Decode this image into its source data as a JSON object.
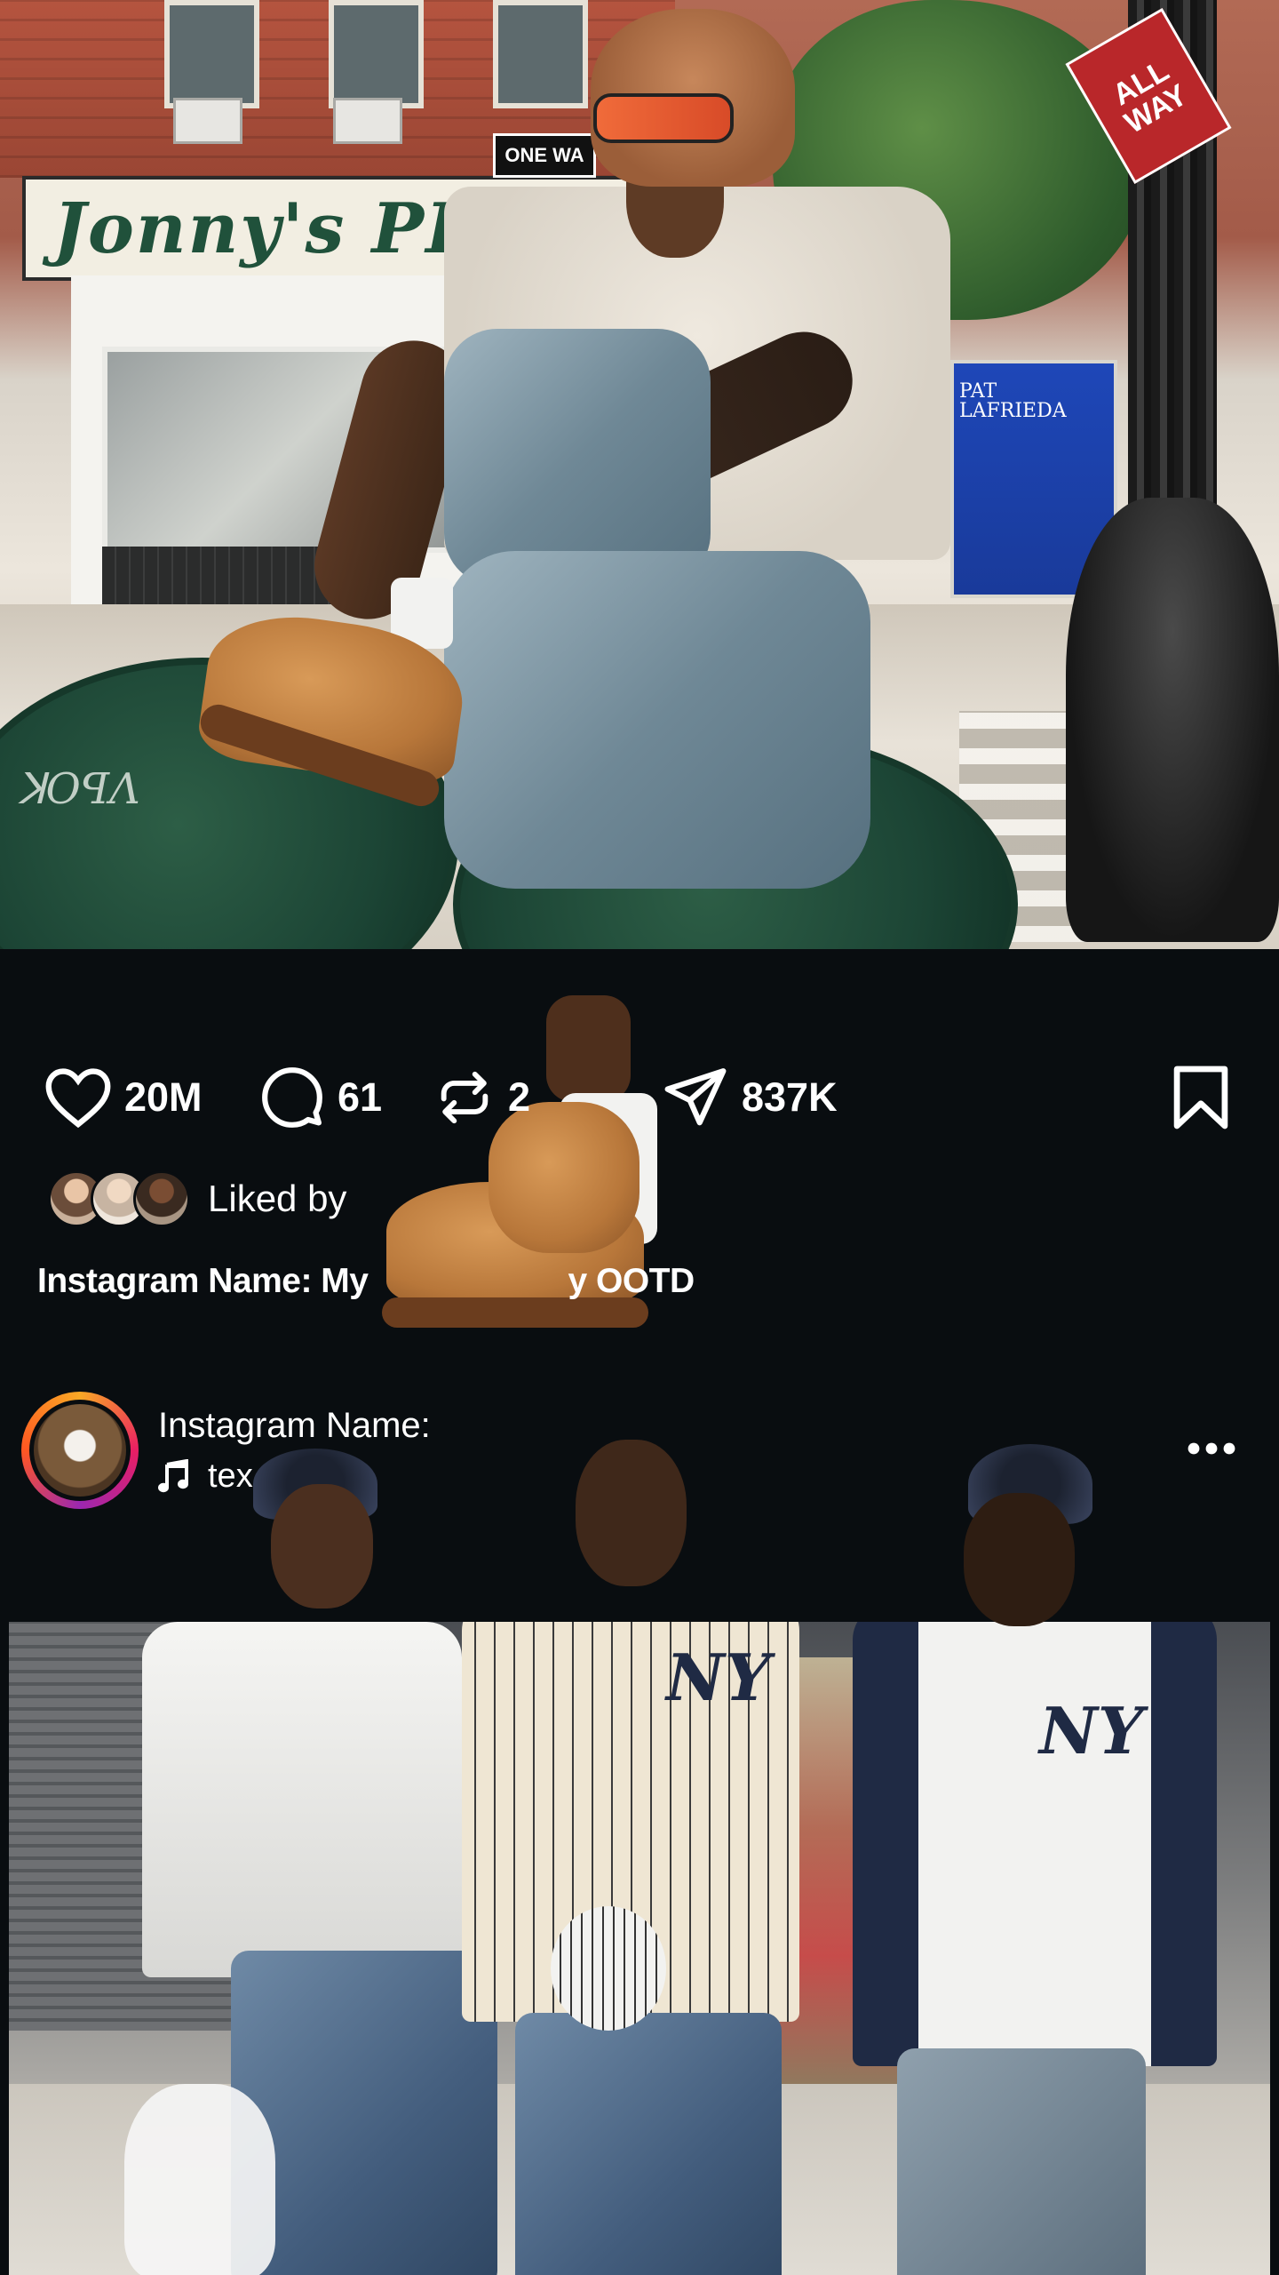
{
  "post1": {
    "actions": {
      "likes": "20M",
      "comments": "61",
      "reposts": "2",
      "shares": "837K"
    },
    "liked_by_label": "Liked by",
    "caption": "Instagram Name: My",
    "caption_tail": "y OOTD",
    "photo_text": {
      "sign": "Jonny's PIZZA",
      "one_way": "ONE WA",
      "all_way": "ALL WAY",
      "truck": "PAT LAFRIEDA"
    }
  },
  "post2": {
    "username": "Instagram Name:",
    "audio": "tex",
    "photo_text": {
      "ny": "NY"
    }
  },
  "icons": {
    "like": "heart-icon",
    "comment": "comment-bubble-icon",
    "repost": "repost-icon",
    "share": "paper-plane-icon",
    "save": "bookmark-icon",
    "audio": "music-note-icon",
    "more": "more-dots-icon"
  },
  "colors": {
    "background": "#090d10",
    "text": "#ffffff",
    "story_ring": [
      "#f9a825",
      "#e91e63",
      "#9c27b0"
    ]
  }
}
